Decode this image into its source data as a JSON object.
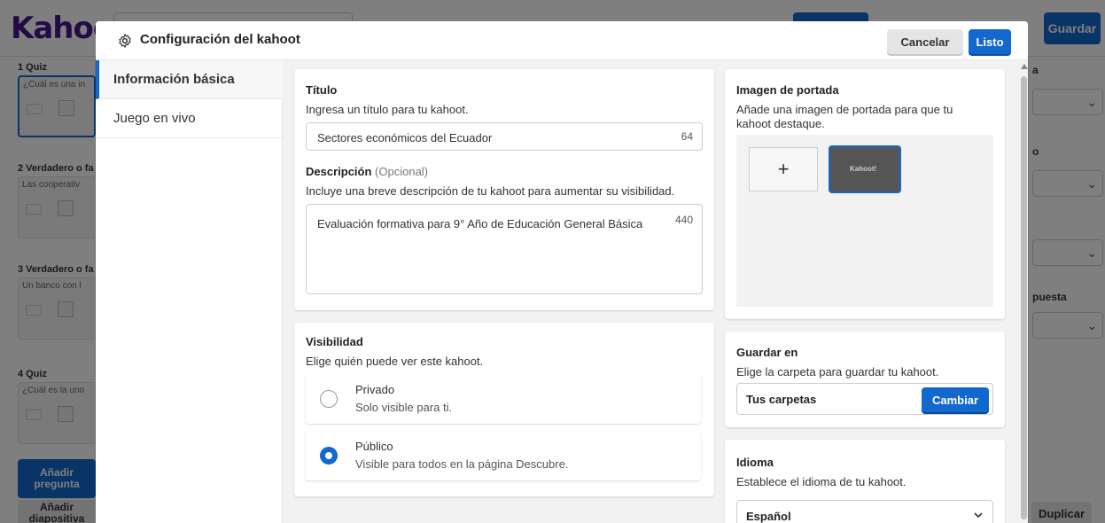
{
  "background": {
    "logo": "Kahoot!",
    "save_label": "Guardar",
    "questions": [
      {
        "title": "1 Quiz",
        "text": "¿Cuál es una in"
      },
      {
        "title": "2 Verdadero o fa",
        "text": "Las cooperativ"
      },
      {
        "title": "3 Verdadero o fa",
        "text": "Un banco con l"
      },
      {
        "title": "4 Quiz",
        "text": "¿Cuál es la uno"
      }
    ],
    "add_question": "Añadir pregunta",
    "add_slide": "Añadir diapositiva",
    "right_labels": [
      "a",
      "o",
      "puesta"
    ],
    "duplicate": "Duplicar"
  },
  "modal": {
    "title": "Configuración del kahoot",
    "cancel_label": "Cancelar",
    "done_label": "Listo",
    "nav": [
      {
        "label": "Información básica"
      },
      {
        "label": "Juego en vivo"
      }
    ],
    "title_section": {
      "heading": "Título",
      "help": "Ingresa un título para tu kahoot.",
      "value": "Sectores económicos del Ecuador",
      "counter": "64"
    },
    "description_section": {
      "heading": "Descripción",
      "optional": "(Opcional)",
      "help": "Incluye una breve descripción de tu kahoot para aumentar su visibilidad.",
      "value": "Evaluación formativa para 9° Año de Educación General Básica",
      "counter": "440"
    },
    "visibility": {
      "heading": "Visibilidad",
      "help": "Elige quién puede ver este kahoot.",
      "options": [
        {
          "label": "Privado",
          "desc": "Solo visible para ti.",
          "selected": false
        },
        {
          "label": "Público",
          "desc": "Visible para todos en la página Descubre.",
          "selected": true
        }
      ]
    },
    "cover": {
      "heading": "Imagen de portada",
      "help": "Añade una imagen de portada para que tu kahoot destaque.",
      "add_symbol": "+",
      "thumb_text": "Kahoot!"
    },
    "save_in": {
      "heading": "Guardar en",
      "help": "Elige la carpeta para guardar tu kahoot.",
      "folder": "Tus carpetas",
      "change_label": "Cambiar"
    },
    "language": {
      "heading": "Idioma",
      "help": "Establece el idioma de tu kahoot.",
      "value": "Español"
    }
  },
  "colors": {
    "accent": "#1368ce",
    "brand": "#46178f"
  }
}
